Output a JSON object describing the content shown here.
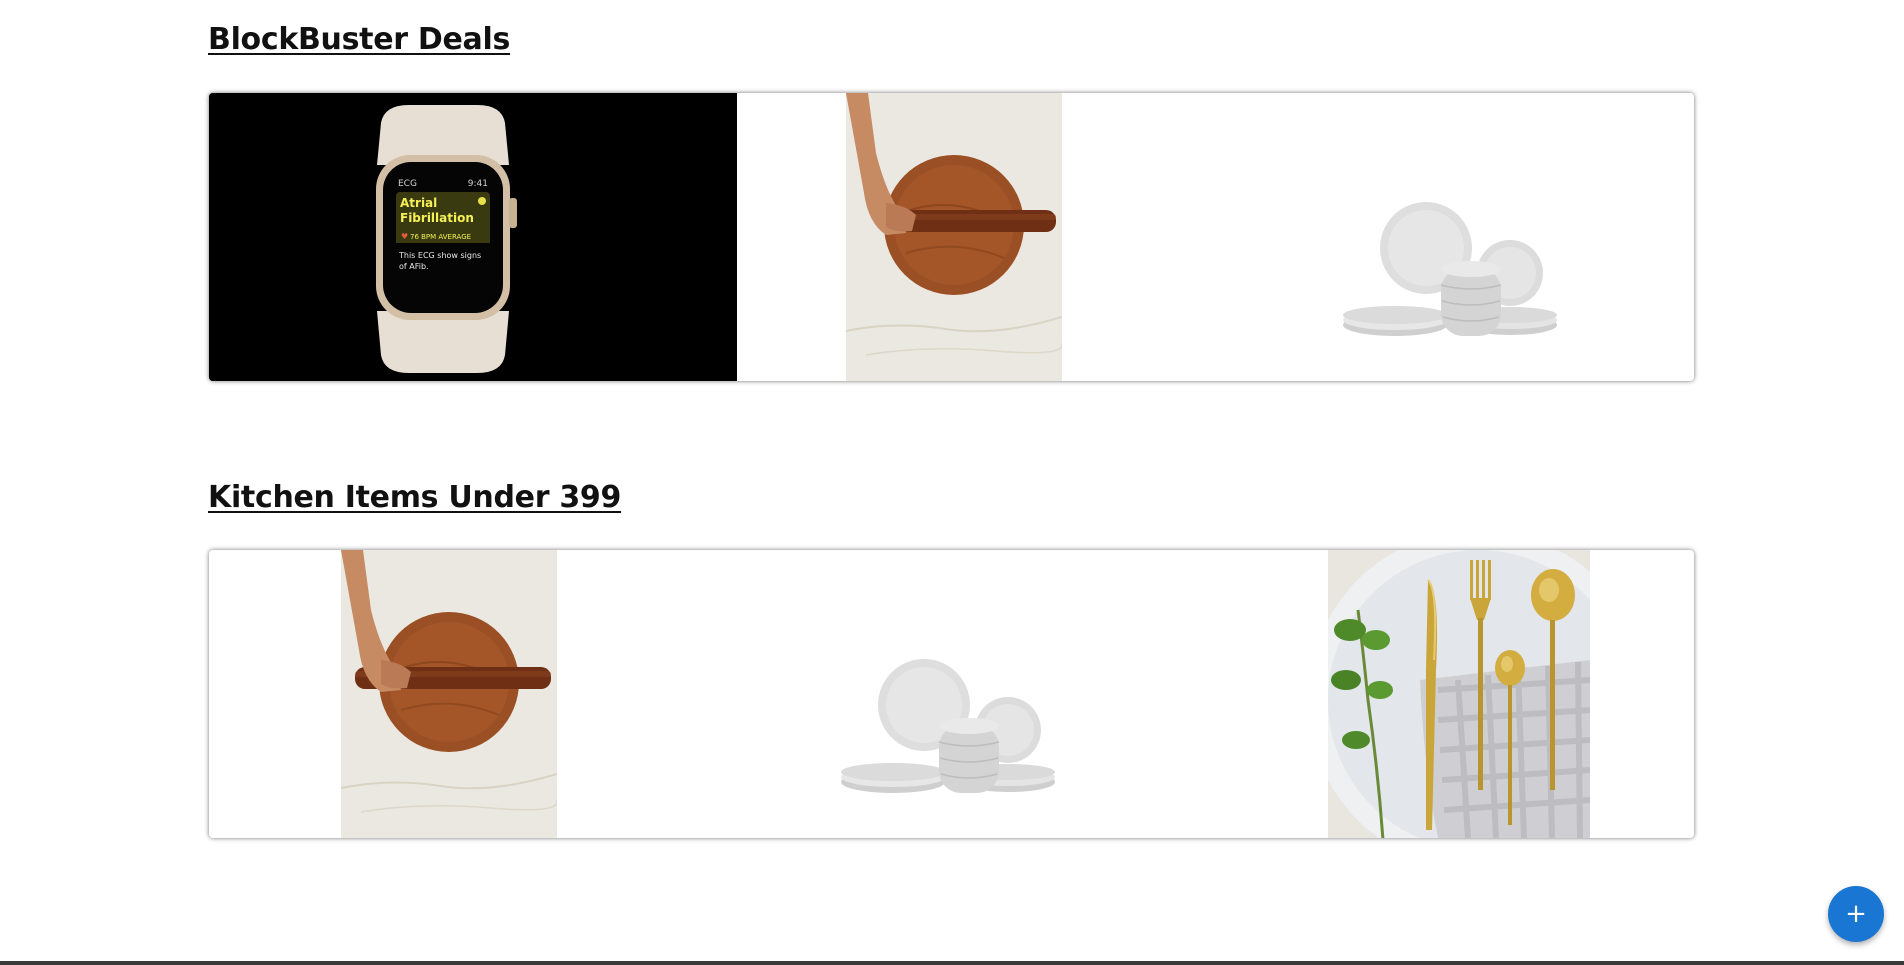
{
  "sections": [
    {
      "title": "BlockBuster Deals",
      "items": [
        {
          "kind": "smartwatch",
          "app": "ECG",
          "time": "9:41",
          "headline_line1": "Atrial",
          "headline_line2": "Fibrillation",
          "bpm": "76 BPM AVERAGE",
          "note_line1": "This ECG show signs",
          "note_line2": "of AFib."
        },
        {
          "kind": "rolling-pin-board"
        },
        {
          "kind": "dinnerware-set"
        }
      ]
    },
    {
      "title": "Kitchen Items Under 399",
      "items": [
        {
          "kind": "rolling-pin-board"
        },
        {
          "kind": "dinnerware-set"
        },
        {
          "kind": "gold-cutlery"
        }
      ]
    }
  ],
  "fab": {
    "icon": "plus-icon",
    "label": "+"
  },
  "colors": {
    "fab": "#1976d2",
    "footer": "#3a3a3a"
  }
}
